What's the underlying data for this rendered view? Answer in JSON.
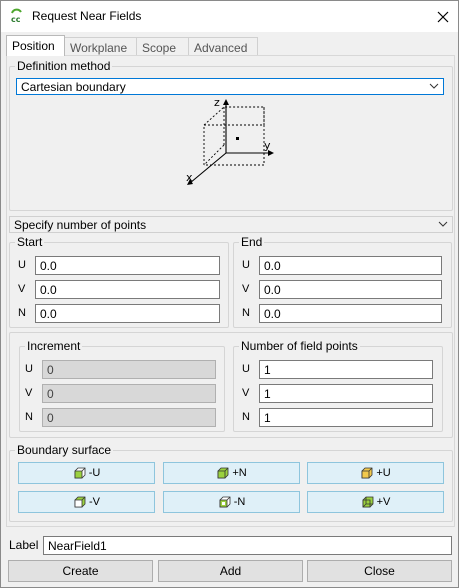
{
  "window": {
    "title": "Request Near Fields"
  },
  "tabs": [
    {
      "label": "Position"
    },
    {
      "label": "Workplane"
    },
    {
      "label": "Scope"
    },
    {
      "label": "Advanced"
    }
  ],
  "definition": {
    "group_label": "Definition method",
    "selected": "Cartesian boundary",
    "diagram_axes": {
      "z": "z",
      "y": "y",
      "x": "x"
    }
  },
  "points_mode": {
    "selected": "Specify number of points"
  },
  "start": {
    "group_label": "Start",
    "fields": [
      {
        "label": "U",
        "value": "0.0"
      },
      {
        "label": "V",
        "value": "0.0"
      },
      {
        "label": "N",
        "value": "0.0"
      }
    ]
  },
  "end": {
    "group_label": "End",
    "fields": [
      {
        "label": "U",
        "value": "0.0"
      },
      {
        "label": "V",
        "value": "0.0"
      },
      {
        "label": "N",
        "value": "0.0"
      }
    ]
  },
  "increment": {
    "group_label": "Increment",
    "fields": [
      {
        "label": "U",
        "value": "0"
      },
      {
        "label": "V",
        "value": "0"
      },
      {
        "label": "N",
        "value": "0"
      }
    ]
  },
  "num_points": {
    "group_label": "Number of field points",
    "fields": [
      {
        "label": "U",
        "value": "1"
      },
      {
        "label": "V",
        "value": "1"
      },
      {
        "label": "N",
        "value": "1"
      }
    ]
  },
  "boundary": {
    "group_label": "Boundary surface",
    "buttons": [
      "-U",
      "+N",
      "+U",
      "-V",
      "-N",
      "+V"
    ]
  },
  "label_field": {
    "label": "Label",
    "value": "NearField1"
  },
  "footer": {
    "create": "Create",
    "add": "Add",
    "close": "Close"
  },
  "colors": {
    "accent": "#0078d7",
    "boundary_button": "#dff0f8",
    "cube_face": "#9bd13f",
    "cube_face_alt": "#f2c94c"
  }
}
